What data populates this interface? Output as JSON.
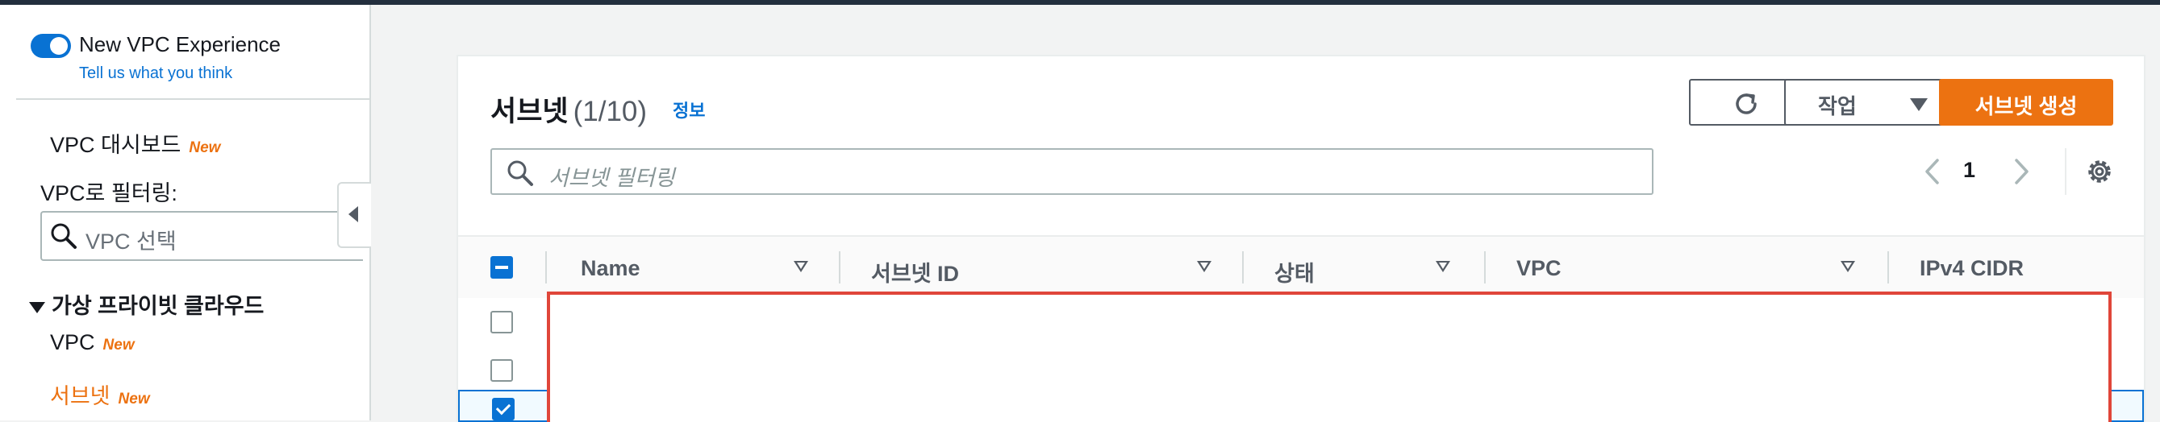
{
  "experience": {
    "toggle_on": true,
    "title": "New VPC Experience",
    "link": "Tell us what you think"
  },
  "sidebar": {
    "dashboard": {
      "label": "VPC 대시보드",
      "badge": "New"
    },
    "filter_label": "VPC로 필터링:",
    "vpc_select_placeholder": "VPC 선택",
    "section_title": "가상 프라이빗 클라우드",
    "items": [
      {
        "label": "VPC",
        "badge": "New",
        "active": false
      },
      {
        "label": "서브넷",
        "badge": "New",
        "active": true
      }
    ]
  },
  "panel": {
    "title": "서브넷",
    "count": "(1/10)",
    "info": "정보",
    "refresh_icon": "refresh-icon",
    "actions_label": "작업",
    "create_label": "서브넷 생성",
    "filter_placeholder": "서브넷 필터링",
    "page": "1",
    "settings_icon": "gear-icon"
  },
  "table": {
    "columns": [
      "Name",
      "서브넷 ID",
      "상태",
      "VPC",
      "IPv4 CIDR"
    ],
    "rows": [
      {
        "selected": false
      },
      {
        "selected": false
      },
      {
        "selected": true
      }
    ]
  },
  "colors": {
    "accent": "#0972d3",
    "brand_orange": "#ec7211",
    "redaction_border": "#e0463a"
  }
}
